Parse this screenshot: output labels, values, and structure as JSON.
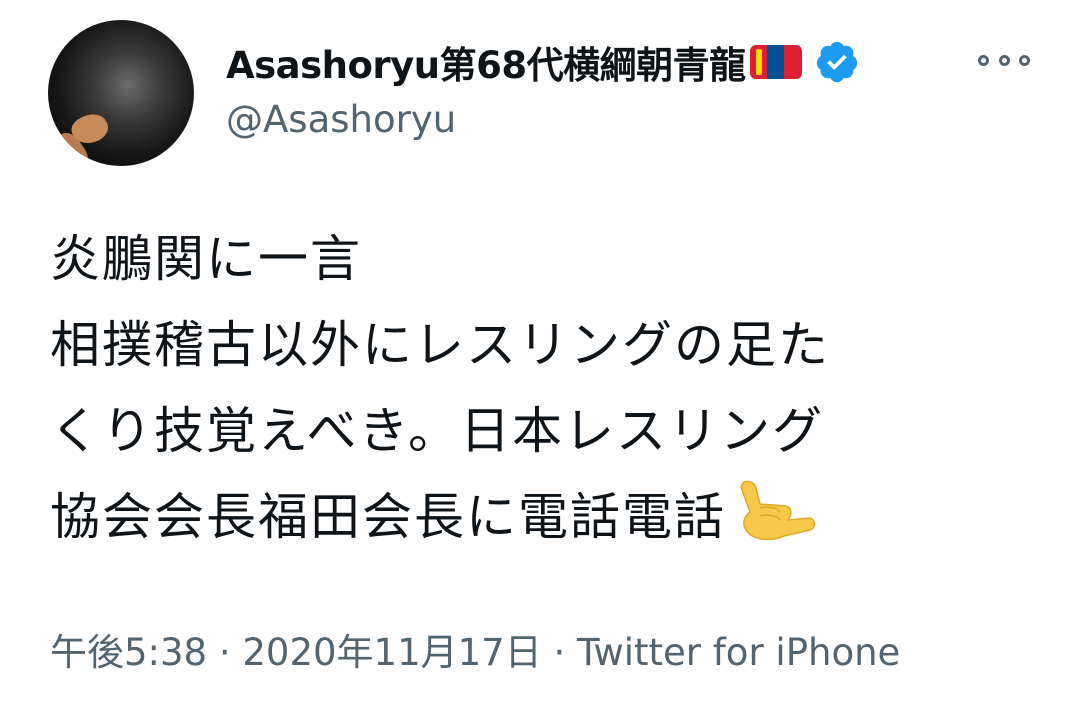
{
  "user": {
    "display_name": "Asashoryu第68代横綱朝青龍",
    "handle": "@Asashoryu",
    "flag_icon": "mongolia-flag-icon",
    "verified_icon": "verified-badge-icon",
    "verified_color": "#1d9bf0"
  },
  "tweet": {
    "lines": [
      "炎鵬関に一言",
      "相撲稽古以外にレスリングの足た",
      "くり技覚えべき。日本レスリング",
      "協会会長福田会長に電話電話"
    ],
    "emoji": "call-me-hand-icon"
  },
  "meta": {
    "time": "午後5:38",
    "separator": "·",
    "date": "2020年11月17日",
    "source": "Twitter for iPhone"
  },
  "colors": {
    "text": "#0f1419",
    "secondary": "#536471"
  }
}
